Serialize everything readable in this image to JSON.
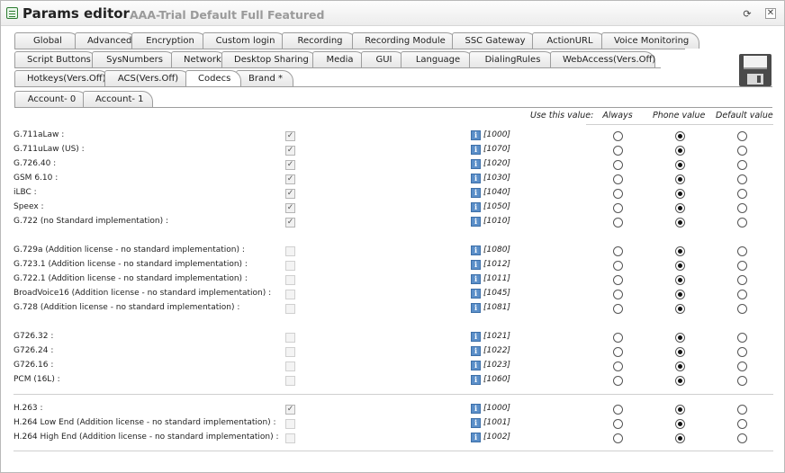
{
  "window": {
    "title": "Params editor",
    "subtitle": "AAA-Trial Default Full Featured",
    "refresh_glyph": "⟳",
    "close_glyph": "✕"
  },
  "tabs": {
    "row1": [
      "Global",
      "Advanced",
      "Encryption",
      "Custom login",
      "Recording",
      "Recording Module",
      "SSC Gateway",
      "ActionURL",
      "Voice Monitoring"
    ],
    "row2": [
      "Script Buttons",
      "SysNumbers",
      "Network",
      "Desktop Sharing",
      "Media",
      "GUI",
      "Language",
      "DialingRules",
      "WebAccess(Vers.Off)"
    ],
    "row3": [
      "Hotkeys(Vers.Off)",
      "ACS(Vers.Off)",
      "Codecs",
      "Brand *"
    ],
    "active": "Codecs"
  },
  "account_tabs": [
    "Account- 0",
    "Account- 1"
  ],
  "columns": {
    "use_value": "Use this value:",
    "always": "Always",
    "phone_value": "Phone value",
    "default_value": "Default value"
  },
  "icons": {
    "app": "params-editor-icon",
    "refresh": "refresh-icon",
    "close": "close-icon",
    "save": "floppy-disk-icon",
    "info": "info-icon",
    "check_mark": "✓",
    "info_glyph": "i"
  },
  "codecs": [
    {
      "label": "G.711aLaw :",
      "checked": true,
      "enabled": true,
      "code": "[1000]",
      "selected": "phone"
    },
    {
      "label": "G.711uLaw (US) :",
      "checked": true,
      "enabled": true,
      "code": "[1070]",
      "selected": "phone"
    },
    {
      "label": "G.726.40 :",
      "checked": true,
      "enabled": true,
      "code": "[1020]",
      "selected": "phone"
    },
    {
      "label": "GSM 6.10 :",
      "checked": true,
      "enabled": true,
      "code": "[1030]",
      "selected": "phone"
    },
    {
      "label": "iLBC :",
      "checked": true,
      "enabled": true,
      "code": "[1040]",
      "selected": "phone"
    },
    {
      "label": "Speex :",
      "checked": true,
      "enabled": true,
      "code": "[1050]",
      "selected": "phone"
    },
    {
      "label": "G.722 (no Standard implementation) :",
      "checked": true,
      "enabled": true,
      "code": "[1010]",
      "selected": "phone"
    },
    {
      "label": "G.729a (Addition license - no standard implementation) :",
      "checked": false,
      "enabled": false,
      "code": "[1080]",
      "selected": "phone"
    },
    {
      "label": "G.723.1 (Addition license - no standard implementation) :",
      "checked": false,
      "enabled": false,
      "code": "[1012]",
      "selected": "phone"
    },
    {
      "label": "G.722.1 (Addition license - no standard implementation) :",
      "checked": false,
      "enabled": false,
      "code": "[1011]",
      "selected": "phone"
    },
    {
      "label": "BroadVoice16 (Addition license - no standard implementation) :",
      "checked": false,
      "enabled": false,
      "code": "[1045]",
      "selected": "phone"
    },
    {
      "label": "G.728 (Addition license - no standard implementation) :",
      "checked": false,
      "enabled": false,
      "code": "[1081]",
      "selected": "phone"
    },
    {
      "label": "G726.32 :",
      "checked": false,
      "enabled": false,
      "code": "[1021]",
      "selected": "phone"
    },
    {
      "label": "G726.24 :",
      "checked": false,
      "enabled": false,
      "code": "[1022]",
      "selected": "phone"
    },
    {
      "label": "G726.16 :",
      "checked": false,
      "enabled": false,
      "code": "[1023]",
      "selected": "phone"
    },
    {
      "label": "PCM (16L) :",
      "checked": false,
      "enabled": false,
      "code": "[1060]",
      "selected": "phone"
    },
    {
      "label": "H.263 :",
      "checked": true,
      "enabled": true,
      "code": "[1000]",
      "selected": "phone"
    },
    {
      "label": "H.264 Low End (Addition license - no standard implementation) :",
      "checked": false,
      "enabled": false,
      "code": "[1001]",
      "selected": "phone"
    },
    {
      "label": "H.264 High End (Addition license - no standard implementation) :",
      "checked": false,
      "enabled": false,
      "code": "[1002]",
      "selected": "phone"
    }
  ]
}
